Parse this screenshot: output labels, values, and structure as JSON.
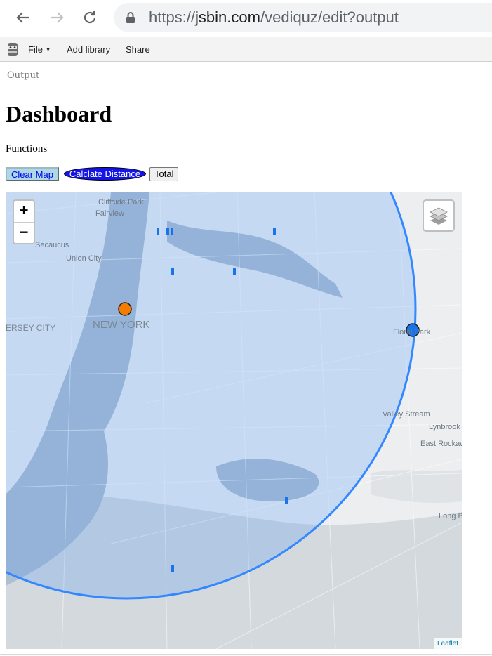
{
  "browser": {
    "url_prefix": "https://",
    "url_host": "jsbin.com",
    "url_path": "/vediquz/edit?output"
  },
  "jsbin_toolbar": {
    "file_label": "File",
    "add_library_label": "Add library",
    "share_label": "Share"
  },
  "page": {
    "output_label": "Output",
    "title": "Dashboard",
    "subtitle": "Functions",
    "buttons": {
      "clear_map": "Clear Map",
      "calculate_distance": "Calclate Distance",
      "total": "Total"
    }
  },
  "map": {
    "zoom_in": "+",
    "zoom_out": "−",
    "attribution": "Leaflet",
    "labels": {
      "cliffside_park": "Cliffside Park",
      "fairview": "Fairview",
      "secaucus": "Secaucus",
      "union_city": "Union City",
      "new_york": "NEW YORK",
      "jersey_city": "JERSEY CITY",
      "floral_park": "Floral Park",
      "valley_stream": "Valley Stream",
      "lynbrook": "Lynbrook",
      "east_rockaway": "East Rockaway",
      "long_beach": "Long Beach"
    },
    "colors": {
      "circle_fill": "#3388ff",
      "circle_stroke": "#3388ff",
      "marker_orange": "#f57c00",
      "marker_blue": "#1a73e8"
    }
  }
}
